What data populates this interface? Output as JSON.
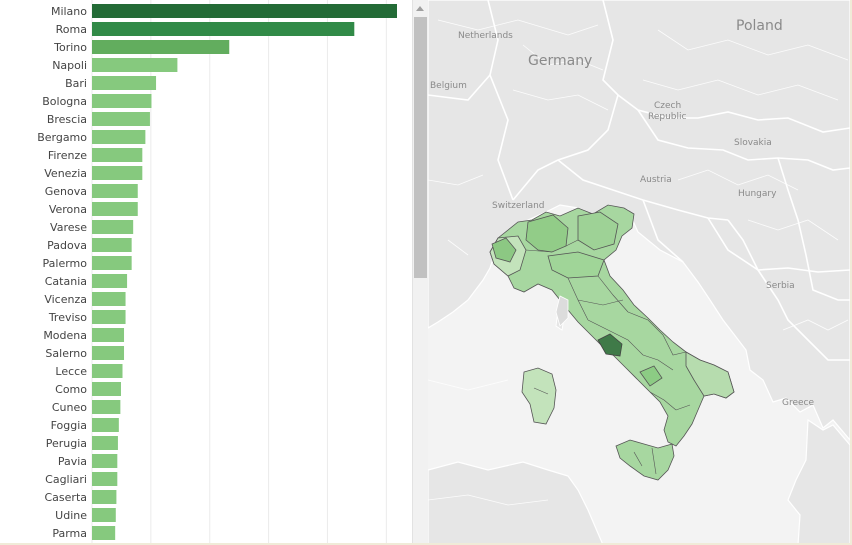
{
  "colors": {
    "bar_darkest": "#236b36",
    "bar_dark": "#318a47",
    "bar_mid": "#62ad5e",
    "bar_light": "#86c97e",
    "map_land": "#e6e6e6",
    "map_sea": "#f3f3f3",
    "italy_light": "#a7d7a0",
    "italy_pale": "#c3e3bb"
  },
  "bar_chart": {
    "chart_data": {
      "type": "bar",
      "orientation": "horizontal",
      "categories": [
        "Milano",
        "Roma",
        "Torino",
        "Napoli",
        "Bari",
        "Bologna",
        "Brescia",
        "Bergamo",
        "Firenze",
        "Venezia",
        "Genova",
        "Verona",
        "Varese",
        "Padova",
        "Palermo",
        "Catania",
        "Vicenza",
        "Treviso",
        "Modena",
        "Salerno",
        "Lecce",
        "Como",
        "Cuneo",
        "Foggia",
        "Perugia",
        "Pavia",
        "Cagliari",
        "Caserta",
        "Udine",
        "Parma"
      ],
      "values": [
        100,
        86,
        45,
        28,
        21,
        19.5,
        19,
        17.5,
        16.5,
        16.5,
        15,
        15,
        13.5,
        13,
        13,
        11.5,
        11,
        11,
        10.5,
        10.5,
        10,
        9.5,
        9.3,
        8.8,
        8.5,
        8.3,
        8.3,
        8,
        7.8,
        7.6
      ],
      "xlim": [
        0,
        100
      ],
      "grid": true
    }
  },
  "map": {
    "country_labels": {
      "netherlands": "Netherlands",
      "germany": "Germany",
      "poland": "Poland",
      "belgium": "Belgium",
      "czech": "Czech Republic",
      "slovakia": "Slovakia",
      "austria": "Austria",
      "hungary": "Hungary",
      "switzerland": "Switzerland",
      "serbia": "Serbia",
      "greece": "Greece"
    }
  }
}
